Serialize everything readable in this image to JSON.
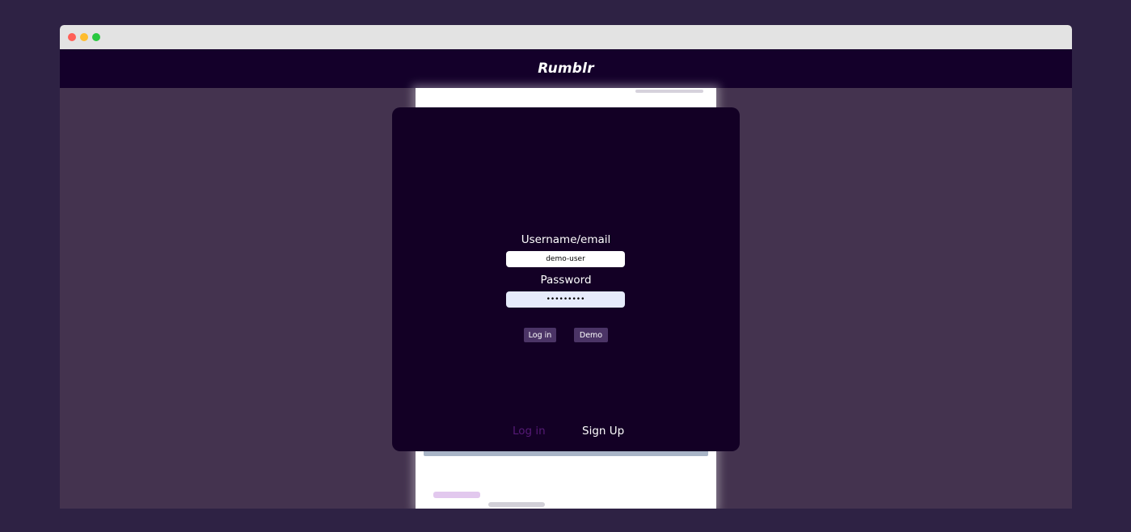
{
  "window": {
    "controls": {
      "close_color": "#ff5f57",
      "minimize_color": "#febc2e",
      "zoom_color": "#28c840"
    }
  },
  "navbar": {
    "brand": "Rumblr"
  },
  "login_modal": {
    "username_label": "Username/email",
    "username_value": "demo-user",
    "password_label": "Password",
    "password_value": "demo-pass",
    "login_button": "Log in",
    "demo_button": "Demo",
    "tabs": {
      "login": "Log in",
      "signup": "Sign Up"
    }
  },
  "colors": {
    "page_bg": "#2e2244",
    "overlay": "#44334f",
    "navbar": "#14002a",
    "modal": "#130025",
    "button": "#4b3466",
    "active_tab": "#561a77"
  }
}
